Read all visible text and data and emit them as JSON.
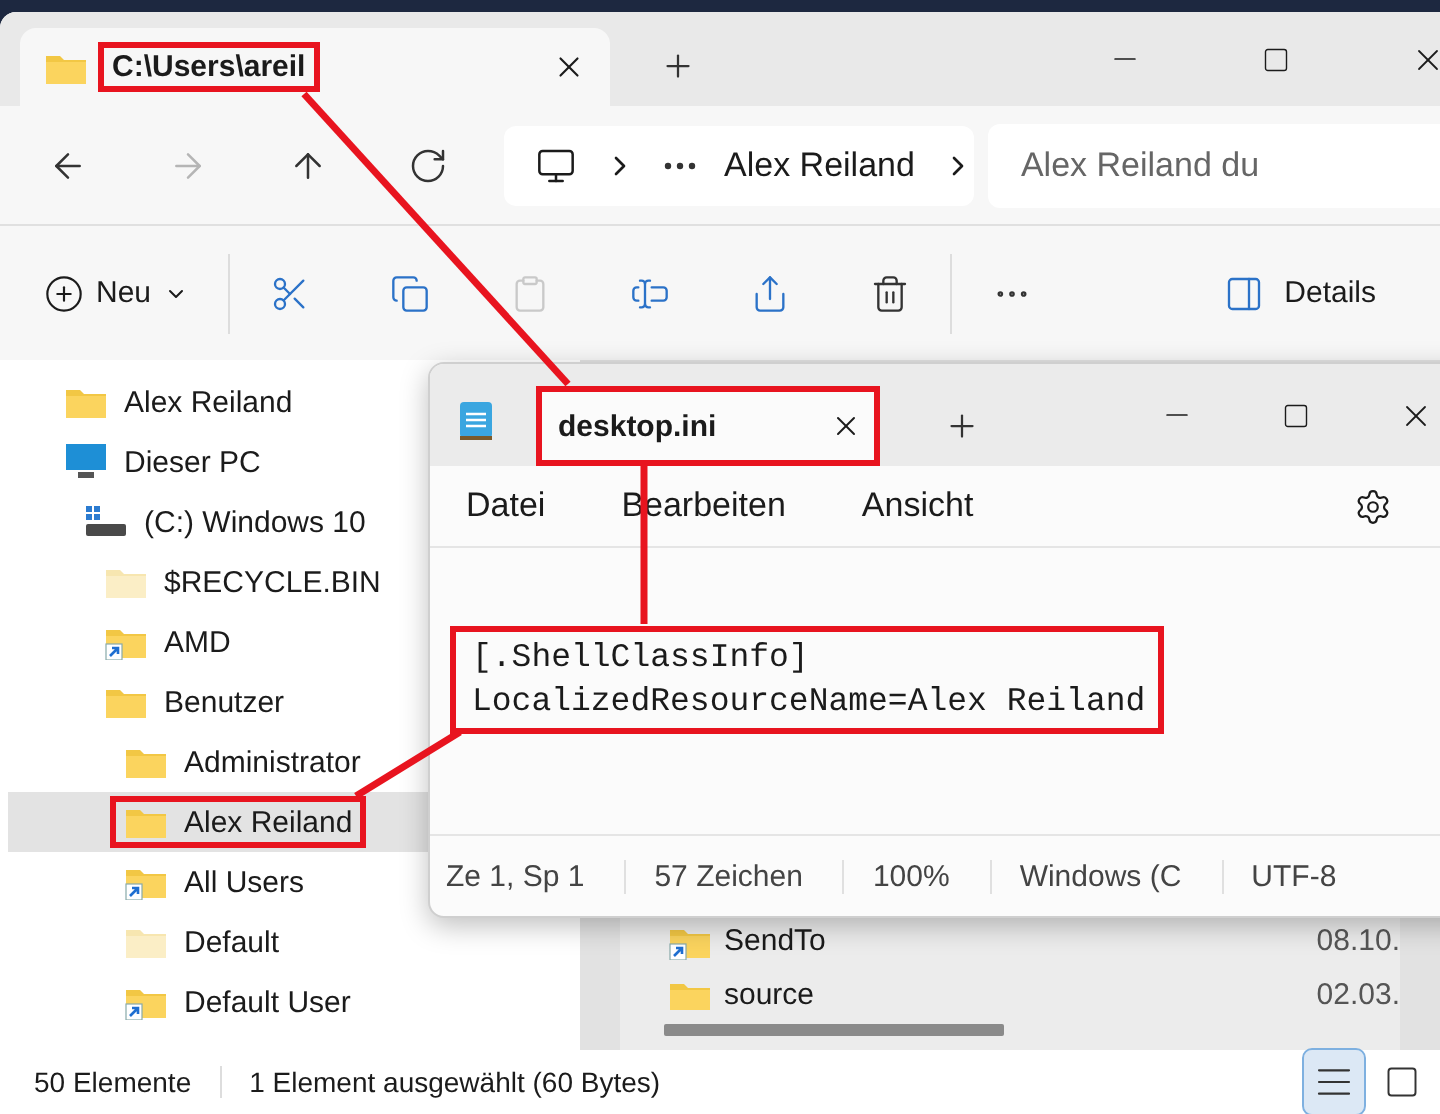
{
  "explorer": {
    "tabs": [
      {
        "label": "C:\\Users\\areil",
        "selected": true,
        "annotated": true
      }
    ],
    "nav_buttons": [
      {
        "kind": "back",
        "disabled": false
      },
      {
        "kind": "forward",
        "disabled": true
      },
      {
        "kind": "up",
        "disabled": false
      },
      {
        "kind": "refresh",
        "disabled": false
      }
    ],
    "breadcrumb": [
      "Alex Reiland"
    ],
    "search": {
      "placeholder": "Alex Reiland du"
    },
    "command_groups": [
      [
        {
          "kind": "new",
          "label": "Neu",
          "disabled": false
        }
      ],
      [
        {
          "kind": "cut",
          "disabled": false
        },
        {
          "kind": "copy",
          "disabled": false
        },
        {
          "kind": "paste",
          "disabled": true
        },
        {
          "kind": "rename",
          "disabled": false
        },
        {
          "kind": "share",
          "disabled": false
        },
        {
          "kind": "delete",
          "disabled": false
        }
      ],
      [
        {
          "kind": "more",
          "disabled": false
        }
      ]
    ],
    "details_button": {
      "label": "Details"
    },
    "sidebar": {
      "items": [
        {
          "label": "Alex Reiland",
          "kind": "folder",
          "selected": false,
          "annotated": false
        },
        {
          "label": "Dieser PC",
          "kind": "pc",
          "selected": false,
          "annotated": false,
          "children": [
            {
              "label": "(C:) Windows 10",
              "kind": "drive",
              "selected": false,
              "annotated": false,
              "children": [
                {
                  "label": "$RECYCLE.BIN",
                  "kind": "hidden",
                  "selected": false,
                  "annotated": false
                },
                {
                  "label": "AMD",
                  "kind": "shortcut",
                  "selected": false,
                  "annotated": false
                },
                {
                  "label": "Benutzer",
                  "kind": "folder",
                  "selected": false,
                  "annotated": false,
                  "children": [
                    {
                      "label": "Administrator",
                      "kind": "folder",
                      "selected": false,
                      "annotated": false
                    },
                    {
                      "label": "Alex Reiland",
                      "kind": "folder",
                      "selected": true,
                      "annotated": true
                    },
                    {
                      "label": "All Users",
                      "kind": "shortcut",
                      "selected": false,
                      "annotated": false
                    },
                    {
                      "label": "Default",
                      "kind": "hidden",
                      "selected": false,
                      "annotated": false
                    },
                    {
                      "label": "Default User",
                      "kind": "shortcut",
                      "selected": false,
                      "annotated": false
                    }
                  ]
                }
              ]
            }
          ]
        }
      ]
    },
    "files": {
      "rows": [
        {
          "name": "SendTo",
          "kind": "shortcut",
          "date": "08.10."
        },
        {
          "name": "source",
          "kind": "folder",
          "date": "02.03."
        }
      ]
    },
    "status_bar": {
      "count": "50 Elemente",
      "selection": "1 Element ausgewählt (60 Bytes)",
      "views": [
        {
          "kind": "details",
          "selected": true
        },
        {
          "kind": "tiles",
          "selected": false
        }
      ]
    }
  },
  "notepad": {
    "tabs": [
      {
        "label": "desktop.ini",
        "selected": true,
        "annotated": true
      }
    ],
    "menu": [
      "Datei",
      "Bearbeiten",
      "Ansicht"
    ],
    "editor": {
      "lines": [
        "[.ShellClassInfo]",
        "LocalizedResourceName=Alex Reiland"
      ],
      "annotated": true
    },
    "status_bar": [
      "Ze 1, Sp 1",
      "57 Zeichen",
      "100%",
      "Windows (C",
      "UTF-8"
    ]
  }
}
